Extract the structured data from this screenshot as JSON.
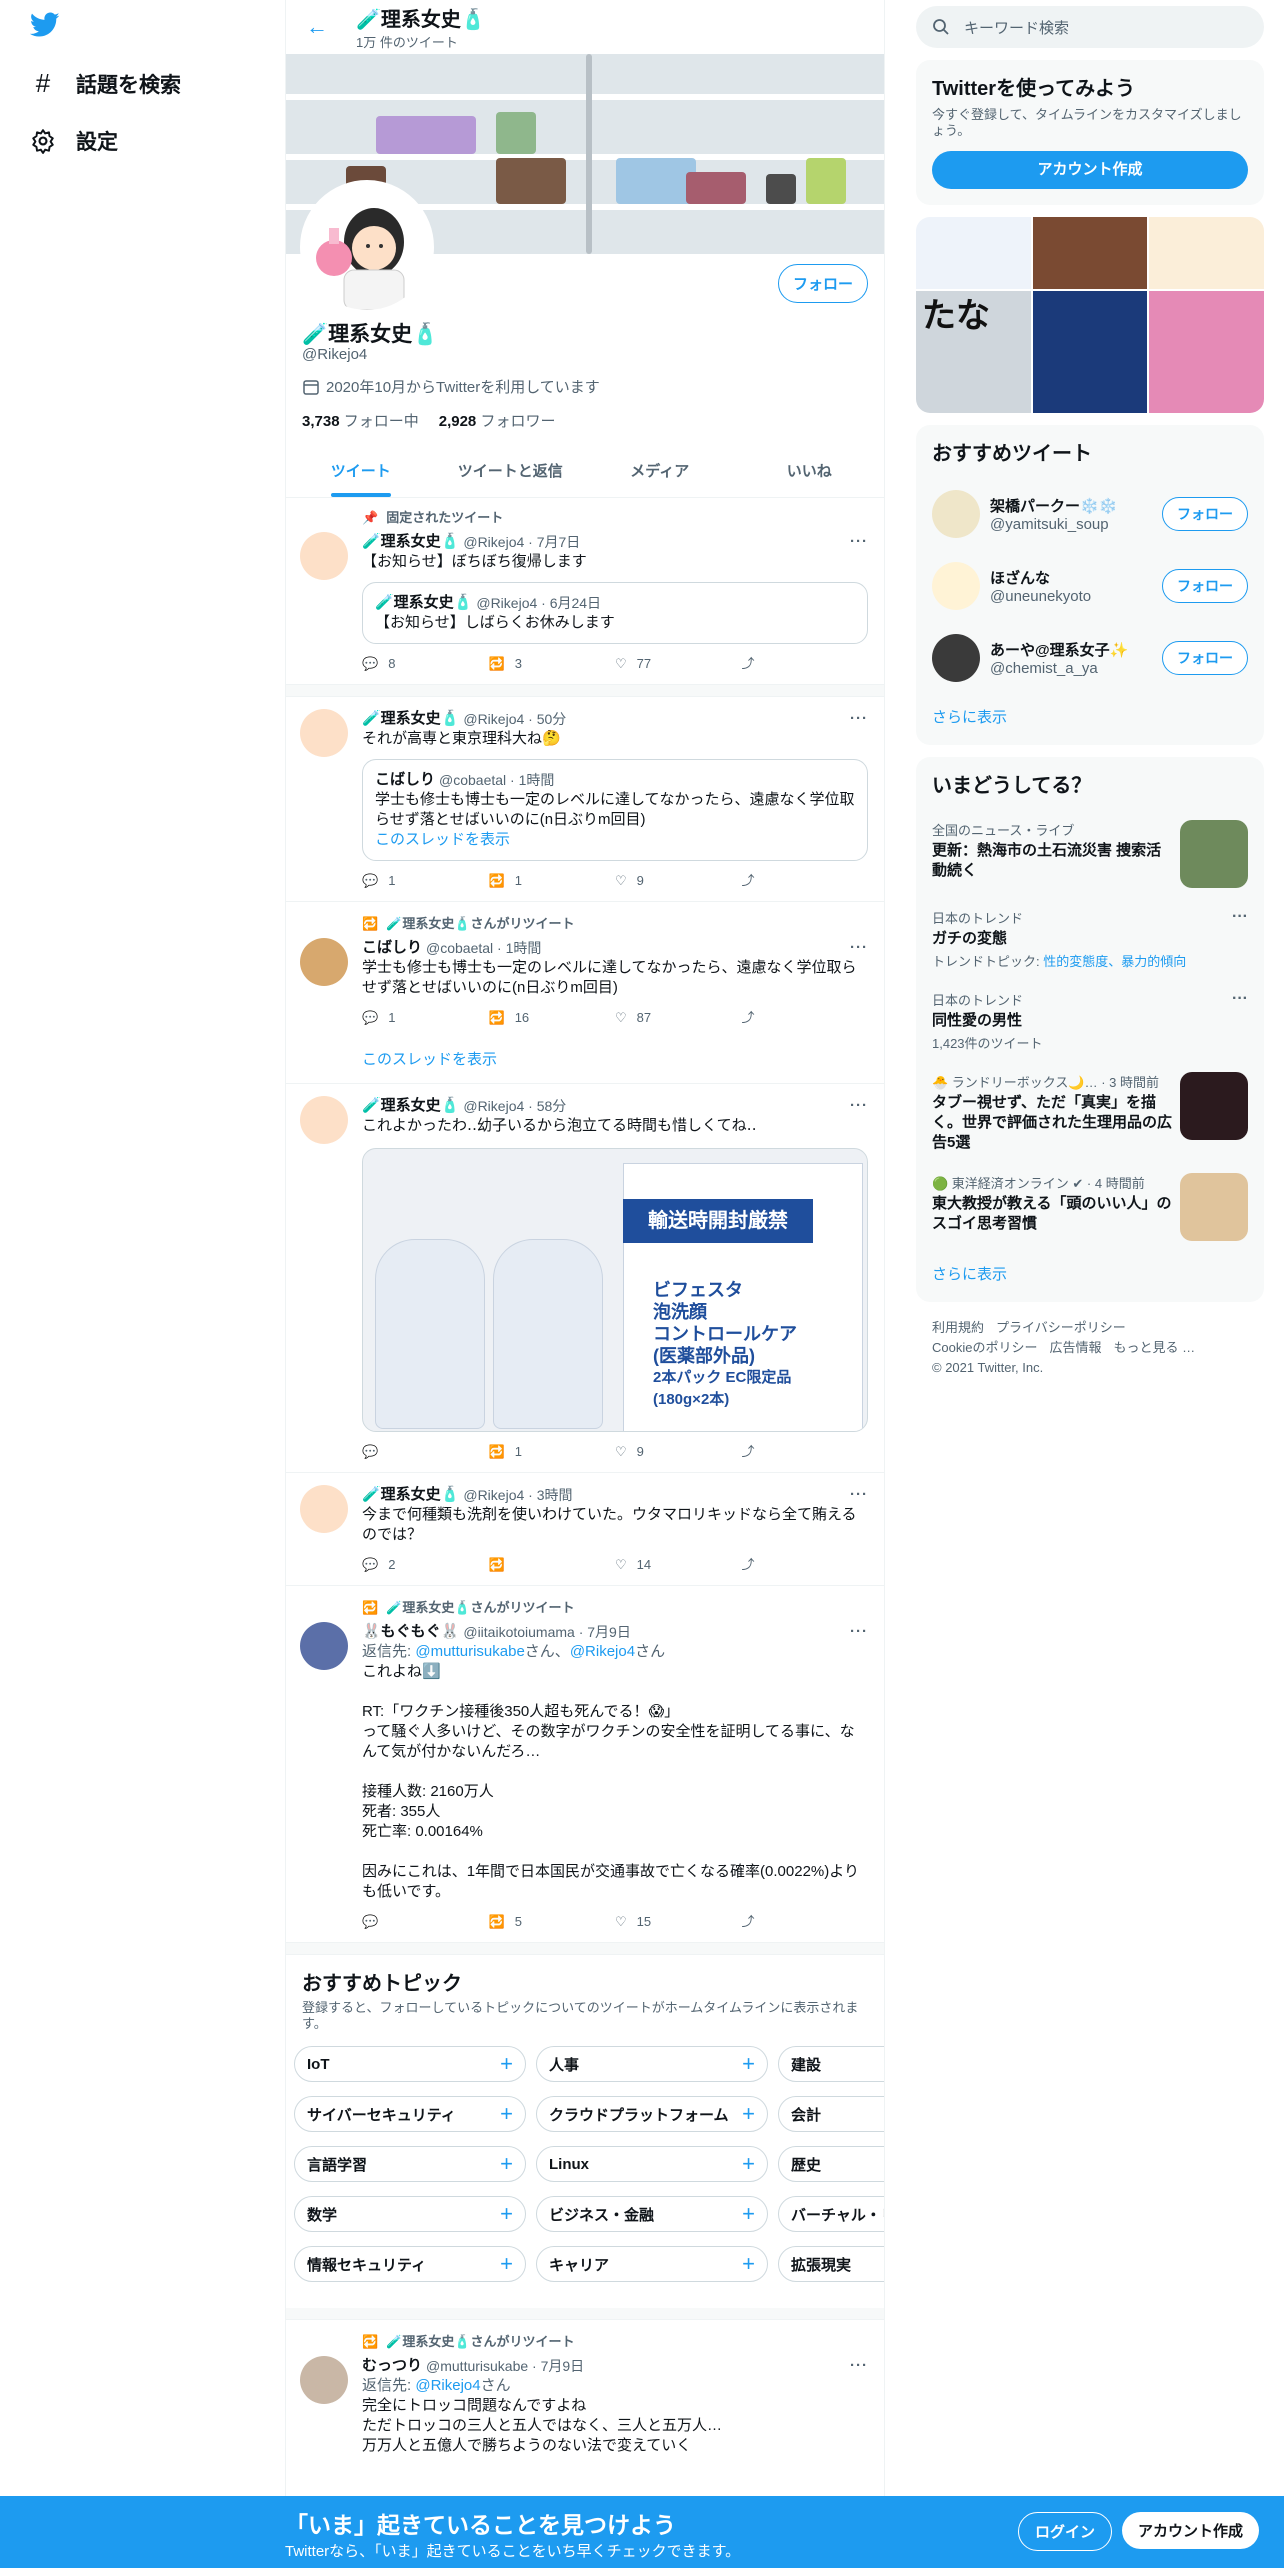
{
  "nav": {
    "logo_icon": "twitter-bird-icon",
    "explore": "話題を検索",
    "settings": "設定"
  },
  "profile": {
    "title": "🧪理系女史🧴",
    "tweet_count": "1万 件のツイート",
    "name": "🧪理系女史🧴",
    "handle": "@Rikejo4",
    "joined": "2020年10月からTwitterを利用しています",
    "following_count": "3,738",
    "following_label": "フォロー中",
    "followers_count": "2,928",
    "followers_label": "フォロワー",
    "follow_button": "フォロー"
  },
  "tabs": [
    "ツイート",
    "ツイートと返信",
    "メディア",
    "いいね"
  ],
  "tweets": [
    {
      "context": "固定されたツイート",
      "name": "🧪理系女史🧴",
      "meta": "@Rikejo4 · 7月7日",
      "text": "【お知らせ】ぼちぼち復帰します",
      "quote_name": "🧪理系女史🧴",
      "quote_meta": "@Rikejo4 · 6月24日",
      "quote_text": "【お知らせ】しばらくお休みします",
      "replies": "8",
      "retweets": "3",
      "likes": "77"
    },
    {
      "name": "🧪理系女史🧴",
      "meta": "@Rikejo4 · 50分",
      "text": "それが高専と東京理科大ね🤔",
      "quote_name": "こばしり",
      "quote_meta": "@cobaetal · 1時間",
      "quote_text": "学士も修士も博士も一定のレベルに達してなかったら、遠慮なく学位取らせず落とせばいいのに(n日ぶりm回目)",
      "quote_link": "このスレッドを表示",
      "replies": "1",
      "retweets": "1",
      "likes": "9"
    },
    {
      "context": "🧪理系女史🧴さんがリツイート",
      "name": "こばしり",
      "meta": "@cobaetal · 1時間",
      "text": "学士も修士も博士も一定のレベルに達してなかったら、遠慮なく学位取らせず落とせばいいのに(n日ぶりm回目)",
      "replies": "1",
      "retweets": "16",
      "likes": "87",
      "show_thread": "このスレッドを表示"
    },
    {
      "name": "🧪理系女史🧴",
      "meta": "@Rikejo4 · 58分",
      "text": "これよかったわ‥幼子いるから泡立てる時間も惜しくてね‥",
      "media_banner": "輸送時開封厳禁",
      "media_lines": [
        "ビフェスタ",
        "泡洗顔",
        "コントロールケア",
        "(医薬部外品)",
        "2本パック EC限定品",
        "(180g×2本)"
      ],
      "replies": "",
      "retweets": "1",
      "likes": "9"
    },
    {
      "name": "🧪理系女史🧴",
      "meta": "@Rikejo4 · 3時間",
      "text": "今まで何種類も洗剤を使いわけていた。ウタマロリキッドなら全て賄えるのでは？",
      "replies": "2",
      "retweets": "",
      "likes": "14"
    },
    {
      "context": "🧪理系女史🧴さんがリツイート",
      "name": "🐰もぐもぐ🐰",
      "meta": "@iitaikotoiumama · 7月9日",
      "reply_prefix": "返信先: ",
      "reply_to1": "@mutturisukabe",
      "reply_mid": "さん、",
      "reply_to2": "@Rikejo4",
      "reply_suffix": "さん",
      "lines": [
        "これよね⬇️",
        "",
        "RT:「ワクチン接種後350人超も死んでる！😱」",
        "って騒ぐ人多いけど、その数字がワクチンの安全性を証明してる事に、なんて気が付かないんだろ…",
        "",
        "接種人数: 2160万人",
        "死者: 355人",
        "死亡率: 0.00164%",
        "",
        "因みにこれは、1年間で日本国民が交通事故で亡くなる確率(0.0022%)よりも低いです。"
      ],
      "replies": "",
      "retweets": "5",
      "likes": "15"
    }
  ],
  "topics": {
    "title": "おすすめトピック",
    "subtitle": "登録すると、フォローしているトピックについてのツイートがホームタイムラインに表示されます。",
    "items": [
      "IoT",
      "人事",
      "建設",
      "サイバーセキュリティ",
      "クラウドプラットフォーム",
      "会計",
      "言語学習",
      "Linux",
      "歴史",
      "数学",
      "ビジネス・金融",
      "バーチャル・リ",
      "情報セキュリティ",
      "キャリア",
      "拡張現実"
    ]
  },
  "last_tweet": {
    "context": "🧪理系女史🧴さんがリツイート",
    "name": "むっつり",
    "meta": "@mutturisukabe · 7月9日",
    "reply_prefix": "返信先: ",
    "reply_to": "@Rikejo4",
    "reply_suffix": "さん",
    "line1": "完全にトロッコ問題なんですよね",
    "line2": "ただトロッコの三人と五人ではなく、三人と五万人…",
    "line3": "万万人と五億人で勝ちようのない法で変えていく"
  },
  "right": {
    "search_placeholder": "キーワード検索",
    "join_title": "Twitterを使ってみよう",
    "join_text": "今すぐ登録して、タイムラインをカスタマイズしましょう。",
    "join_button": "アカウント作成",
    "grid_text": "たな",
    "rec_title": "おすすめツイート",
    "recs": [
      {
        "name": "架橋パークー❄️❄️",
        "handle": "@yamitsuki_soup",
        "button": "フォロー"
      },
      {
        "name": "ほざんな",
        "handle": "@uneunekyoto",
        "button": "フォロー"
      },
      {
        "name": "あーや@理系女子✨",
        "handle": "@chemist_a_ya",
        "button": "フォロー"
      }
    ],
    "rec_more": "さらに表示",
    "trend_title": "いまどうしてる？",
    "trends": [
      {
        "cat": "全国のニュース・ライブ",
        "title": "更新：熱海市の土石流災害 捜索活動続く"
      },
      {
        "cat": "日本のトレンド",
        "title": "ガチの変態",
        "sub_prefix": "トレンドトピック: ",
        "sub_link": "性的変態度、暴力的傾向"
      },
      {
        "cat": "日本のトレンド",
        "title": "同性愛の男性",
        "sub": "1,423件のツイート"
      },
      {
        "cat": "🐣 ランドリーボックス🌙…  · 3 時間前",
        "title": "タブー視せず、ただ「真実」を描く。世界で評価された生理用品の広告5選"
      },
      {
        "cat": "🟢 東洋経済オンライン ✔ · 4 時間前",
        "title": "東大教授が教える「頭のいい人」のスゴイ思考習慣"
      }
    ],
    "trend_more": "さらに表示",
    "footer": [
      "利用規約",
      "プライバシーポリシー",
      "Cookieのポリシー",
      "広告情報",
      "もっと見る …",
      "© 2021 Twitter, Inc."
    ]
  },
  "bottom": {
    "title": "「いま」起きていることを見つけよう",
    "subtitle": "Twitterなら、「いま」起きていることをいち早くチェックできます。",
    "login": "ログイン",
    "signup": "アカウント作成"
  },
  "colors": {
    "accent": "#1d9bf0",
    "text": "#0f1419",
    "muted": "#536471",
    "border": "#eff3f4"
  }
}
